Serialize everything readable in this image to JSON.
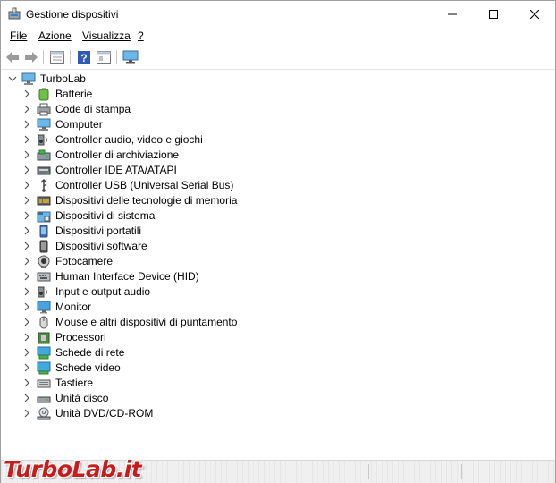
{
  "window": {
    "title": "Gestione dispositivi",
    "icons": {
      "app": "device-manager-icon",
      "minimize": "minimize-icon",
      "maximize": "maximize-icon",
      "close": "close-icon"
    }
  },
  "menu": [
    {
      "label": "File",
      "icon": ""
    },
    {
      "label": "Azione",
      "icon": ""
    },
    {
      "label": "Visualizza",
      "icon": ""
    },
    {
      "label": "?",
      "icon": ""
    }
  ],
  "toolbar": {
    "buttons": [
      "back-arrow-icon",
      "forward-arrow-icon",
      "properties-icon",
      "help-icon",
      "view-icon",
      "monitor-scan-icon"
    ]
  },
  "tree": {
    "root": {
      "label": "TurboLab",
      "icon": "computer-icon",
      "expanded": true
    },
    "items": [
      {
        "label": "Batterie",
        "icon": "battery-icon"
      },
      {
        "label": "Code di stampa",
        "icon": "printer-icon"
      },
      {
        "label": "Computer",
        "icon": "computer-icon"
      },
      {
        "label": "Controller audio, video e giochi",
        "icon": "speaker-icon"
      },
      {
        "label": "Controller di archiviazione",
        "icon": "storage-controller-icon"
      },
      {
        "label": "Controller IDE ATA/ATAPI",
        "icon": "ide-controller-icon"
      },
      {
        "label": "Controller USB (Universal Serial Bus)",
        "icon": "usb-icon"
      },
      {
        "label": "Dispositivi delle tecnologie di memoria",
        "icon": "memory-icon"
      },
      {
        "label": "Dispositivi di sistema",
        "icon": "system-folder-icon"
      },
      {
        "label": "Dispositivi portatili",
        "icon": "portable-device-icon"
      },
      {
        "label": "Dispositivi software",
        "icon": "software-device-icon"
      },
      {
        "label": "Fotocamere",
        "icon": "camera-icon"
      },
      {
        "label": "Human Interface Device (HID)",
        "icon": "hid-icon"
      },
      {
        "label": "Input e output audio",
        "icon": "speaker-icon"
      },
      {
        "label": "Monitor",
        "icon": "monitor-icon"
      },
      {
        "label": "Mouse e altri dispositivi di puntamento",
        "icon": "mouse-icon"
      },
      {
        "label": "Processori",
        "icon": "processor-icon"
      },
      {
        "label": "Schede di rete",
        "icon": "network-adapter-icon"
      },
      {
        "label": "Schede video",
        "icon": "display-adapter-icon"
      },
      {
        "label": "Tastiere",
        "icon": "keyboard-icon"
      },
      {
        "label": "Unità disco",
        "icon": "disk-drive-icon"
      },
      {
        "label": "Unità DVD/CD-ROM",
        "icon": "dvd-drive-icon"
      }
    ]
  },
  "watermark": "TurboLab.it",
  "colors": {
    "accent": "#0078d7",
    "watermark": "#c61e1e"
  }
}
